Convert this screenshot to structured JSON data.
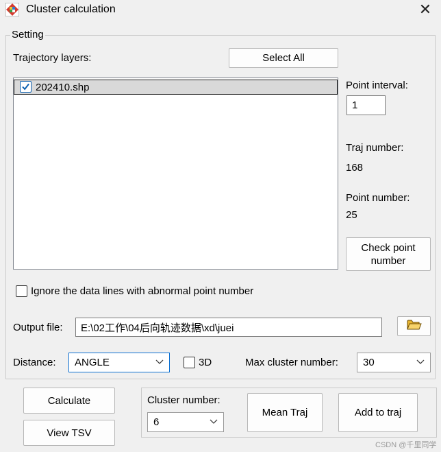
{
  "window": {
    "title": "Cluster calculation",
    "app_icon": "color-grid-app-icon",
    "close_icon": "close-icon",
    "close_glyph": "✕"
  },
  "setting": {
    "legend": "Setting",
    "trajectory_layers_label": "Trajectory layers:",
    "select_all_label": "Select All",
    "layers": [
      {
        "name": "202410.shp",
        "checked": true
      }
    ],
    "point_interval_label": "Point interval:",
    "point_interval_value": "1",
    "traj_number_label": "Traj number:",
    "traj_number_value": "168",
    "point_number_label": "Point number:",
    "point_number_value": "25",
    "check_point_label_line1": "Check point",
    "check_point_label_line2": "number",
    "ignore_label": "Ignore the data lines with abnormal point number",
    "ignore_checked": false,
    "output_file_label": "Output file:",
    "output_file_value": "E:\\02工作\\04后向轨迹数据\\xd\\juei",
    "browse_icon": "open-folder-icon",
    "distance_label": "Distance:",
    "distance_value": "ANGLE",
    "three_d_label": "3D",
    "three_d_checked": false,
    "max_cluster_label": "Max cluster number:",
    "max_cluster_value": "30"
  },
  "bottom": {
    "calculate_label": "Calculate",
    "view_tsv_label": "View TSV",
    "cluster_number_label": "Cluster number:",
    "cluster_number_value": "6",
    "mean_traj_label": "Mean Traj",
    "add_to_traj_label": "Add to traj"
  },
  "watermark": "CSDN @千里同学",
  "colors": {
    "background": "#f0f0f0",
    "selection": "#d9d9d9",
    "check_accent": "#0a5fb0",
    "focus_border": "#0a6fd1"
  }
}
